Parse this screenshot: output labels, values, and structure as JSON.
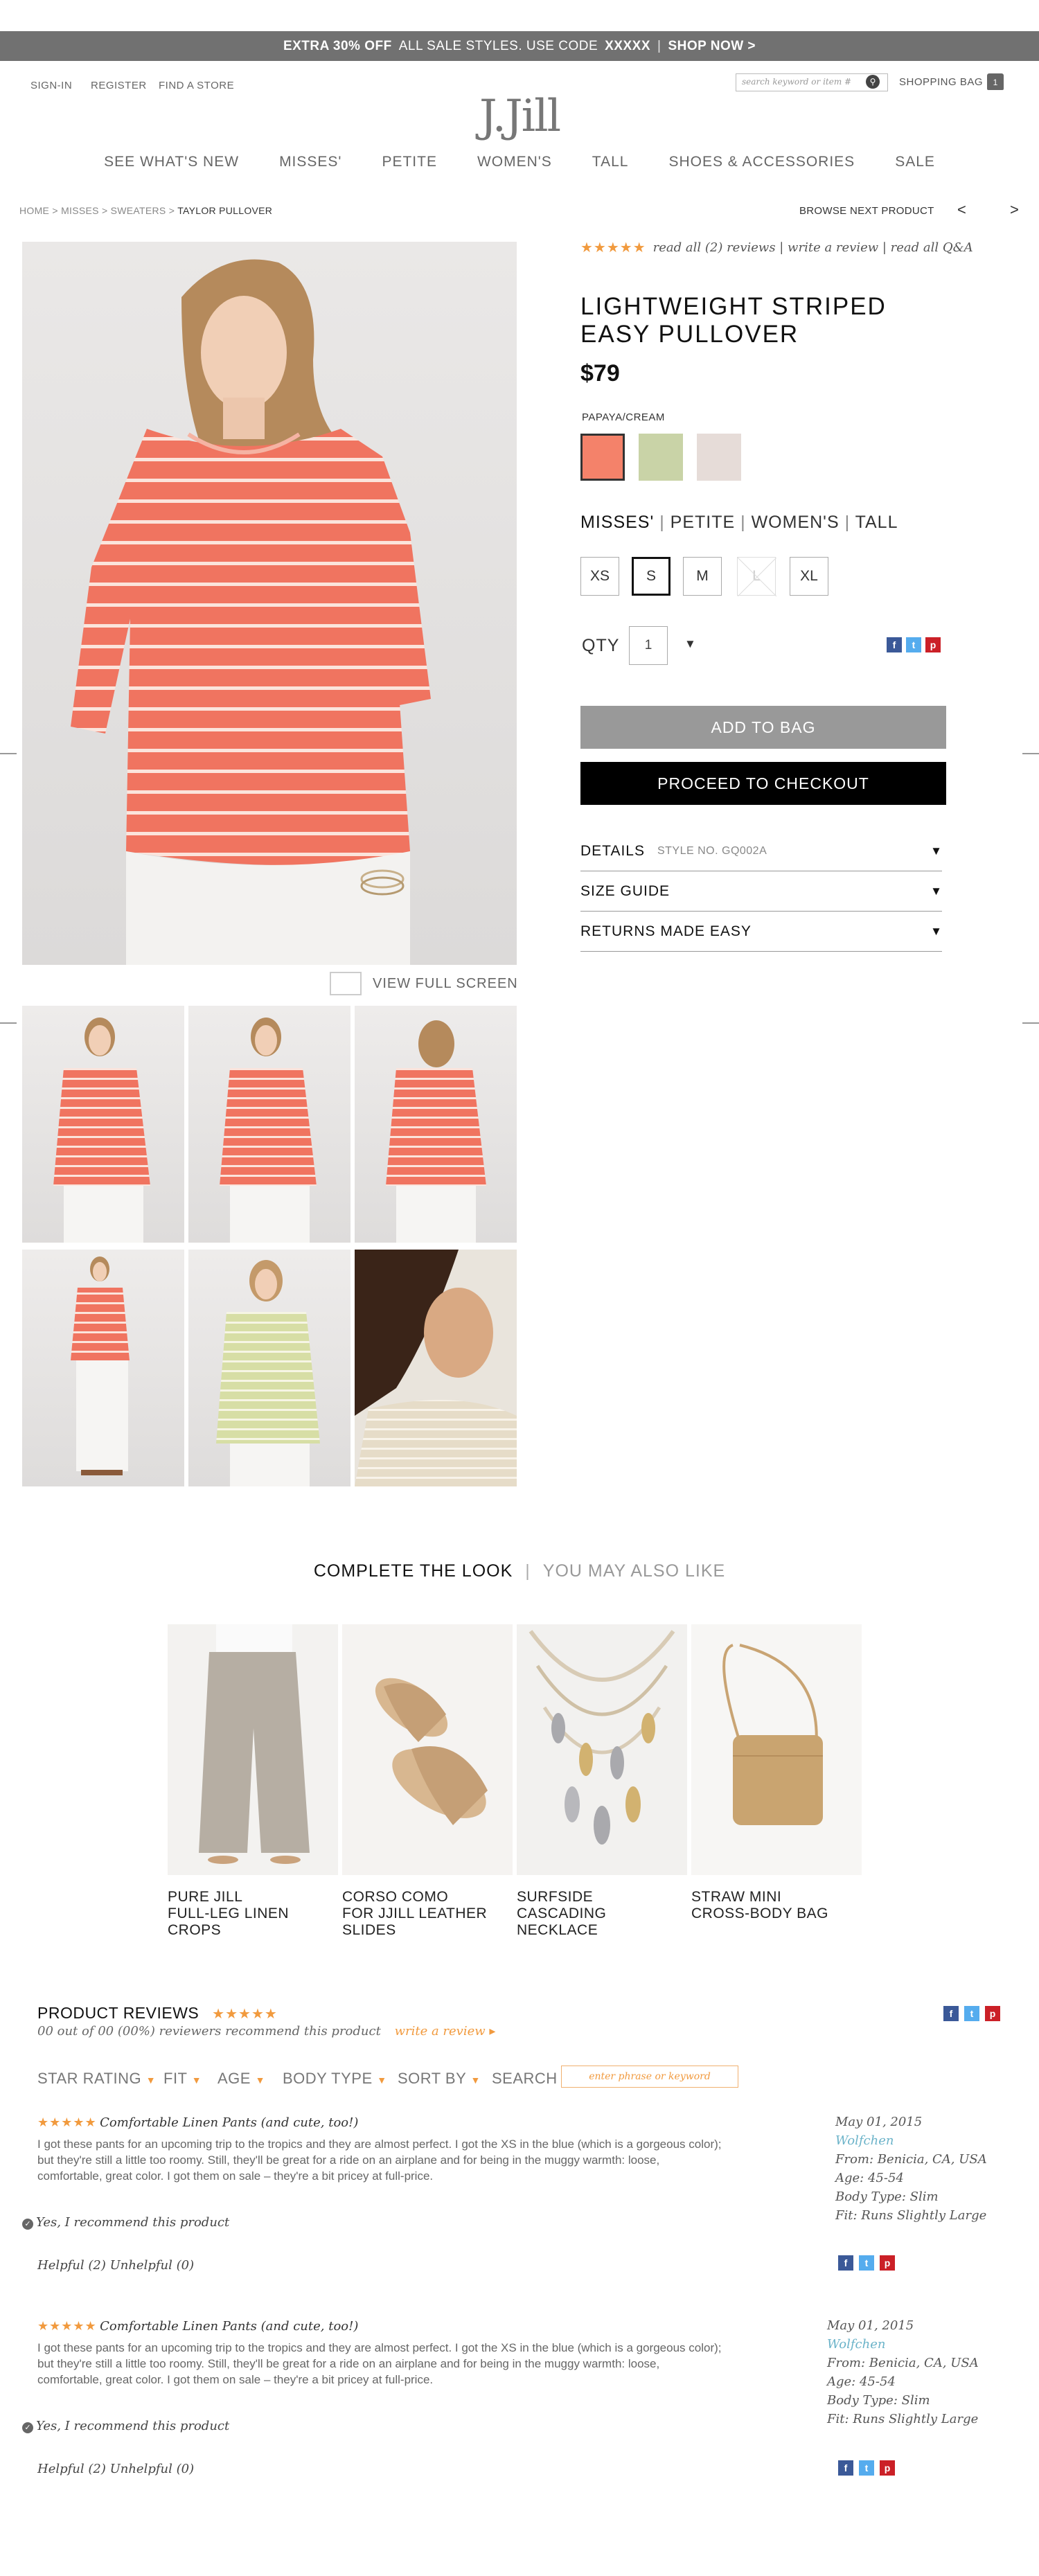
{
  "promo": {
    "bold": "EXTRA 30% OFF",
    "text": "ALL SALE STYLES. USE CODE",
    "code": "XXXXX",
    "cta": "SHOP NOW >"
  },
  "util": {
    "signin": "SIGN-IN",
    "register": "REGISTER",
    "find_store": "FIND A STORE"
  },
  "logo": "J.Jill",
  "search": {
    "placeholder": "search keyword or item #"
  },
  "bag": {
    "label": "SHOPPING BAG",
    "count": "1"
  },
  "nav": [
    "SEE WHAT'S NEW",
    "MISSES'",
    "PETITE",
    "WOMEN'S",
    "TALL",
    "SHOES & ACCESSORIES",
    "SALE"
  ],
  "breadcrumb": {
    "home": "HOME",
    "misses": "MISSES",
    "sweaters": "SWEATERS",
    "current": "TAYLOR PULLOVER"
  },
  "browse_next": "BROWSE NEXT PRODUCT",
  "view_full_screen": "VIEW FULL SCREEN",
  "product": {
    "rating_stars": "★★★★★",
    "reviews_link": "read all (2) reviews | write a review | read all Q&A",
    "title_line1": "LIGHTWEIGHT STRIPED",
    "title_line2": "EASY PULLOVER",
    "price": "$79",
    "color_label": "PAPAYA/CREAM",
    "swatches": [
      "#f4826a",
      "#c9d3a7",
      "#e6dcd8"
    ],
    "fits": [
      "MISSES'",
      "PETITE",
      "WOMEN'S",
      "TALL"
    ],
    "sizes": [
      "XS",
      "S",
      "M",
      "L",
      "XL"
    ],
    "qty_label": "QTY",
    "qty": "1",
    "add_to_bag": "ADD TO BAG",
    "checkout": "PROCEED TO CHECKOUT",
    "details": "DETAILS",
    "style_no": "STYLE NO. GQ002A",
    "size_guide": "SIZE GUIDE",
    "returns": "RETURNS MADE EASY"
  },
  "complete_look": {
    "tab_active": "COMPLETE THE LOOK",
    "tab_other": "YOU MAY ALSO LIKE",
    "items": [
      {
        "l1": "PURE JILL",
        "l2": "FULL-LEG LINEN",
        "l3": "CROPS"
      },
      {
        "l1": "CORSO COMO",
        "l2": "FOR JJILL LEATHER",
        "l3": "SLIDES"
      },
      {
        "l1": "SURFSIDE",
        "l2": "CASCADING",
        "l3": "NECKLACE"
      },
      {
        "l1": "STRAW MINI",
        "l2": "CROSS-BODY BAG",
        "l3": ""
      }
    ]
  },
  "reviews": {
    "heading": "PRODUCT REVIEWS",
    "stars": "★★★★★",
    "summary": "00 out of 00 (00%) reviewers recommend this product",
    "write": "write a review ▸",
    "filters": [
      "STAR RATING",
      "FIT",
      "AGE",
      "BODY TYPE",
      "SORT BY"
    ],
    "search_label": "SEARCH",
    "search_placeholder": "enter phrase or keyword",
    "items": [
      {
        "stars": "★★★★★",
        "title": "Comfortable Linen Pants (and cute, too!)",
        "body": "I got these pants for an upcoming trip to the tropics and they are almost perfect. I got the XS in the blue (which is a gorgeous color); but they're still a little too roomy. Still, they'll be great for a ride on an airplane and for being in the muggy warmth: loose, comfortable, great color. I got them on sale – they're a bit pricey at full-price.",
        "recommend": "Yes, I recommend this product",
        "helpful": "Helpful (2) Unhelpful (0)",
        "date": "May 01, 2015",
        "nick": "Wolfchen",
        "from": "From: Benicia, CA, USA",
        "age": "Age: 45-54",
        "body_type": "Body Type: Slim",
        "fit": "Fit: Runs Slightly Large"
      },
      {
        "stars": "★★★★★",
        "title": "Comfortable Linen Pants (and cute, too!)",
        "body": "I got these pants for an upcoming trip to the tropics and they are almost perfect. I got the XS in the blue (which is a gorgeous color); but they're still a little too roomy. Still, they'll be great for a ride on an airplane and for being in the muggy warmth: loose, comfortable, great color. I got them on sale – they're a bit pricey at full-price.",
        "recommend": "Yes, I recommend this product",
        "helpful": "Helpful (2) Unhelpful (0)",
        "date": "May 01, 2015",
        "nick": "Wolfchen",
        "from": "From: Benicia, CA, USA",
        "age": "Age: 45-54",
        "body_type": "Body Type: Slim",
        "fit": "Fit: Runs Slightly Large"
      }
    ]
  }
}
